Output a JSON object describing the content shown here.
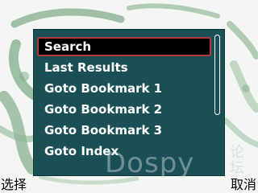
{
  "menu": {
    "items": [
      {
        "label": "Search",
        "selected": true
      },
      {
        "label": "Last Results",
        "selected": false
      },
      {
        "label": "Goto Bookmark 1",
        "selected": false
      },
      {
        "label": "Goto Bookmark 2",
        "selected": false
      },
      {
        "label": "Goto Bookmark 3",
        "selected": false
      },
      {
        "label": "Goto Index",
        "selected": false
      }
    ]
  },
  "softkeys": {
    "left_label": "选择",
    "right_label": "取消"
  },
  "watermark": {
    "latin": "Dospy",
    "cjk": "论坛"
  },
  "colors": {
    "panel": "#1b4f56",
    "selection_border": "#b43a3a",
    "wallpaper_brush": "#6ea278"
  }
}
